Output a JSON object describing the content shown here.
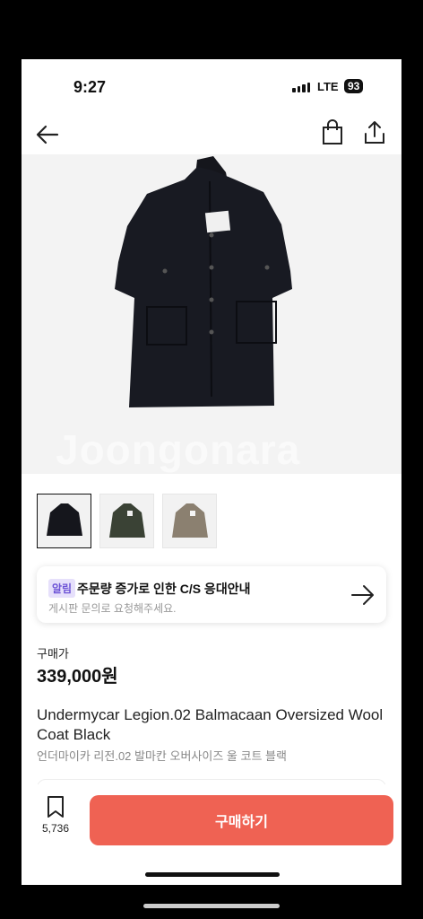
{
  "status_bar": {
    "time": "9:27",
    "network": "LTE",
    "battery": "93"
  },
  "header": {
    "back_icon": "arrow-left-icon",
    "bag_icon": "shopping-bag-icon",
    "share_icon": "share-icon"
  },
  "gallery": {
    "watermark": "Joongonara",
    "thumbnails": [
      {
        "color": "black",
        "active": true
      },
      {
        "color": "dark green",
        "active": false
      },
      {
        "color": "taupe",
        "active": false
      }
    ]
  },
  "notice": {
    "badge": "알림",
    "title": "주문량 증가로 인한 C/S 응대안내",
    "subtitle": "게시판 문의로 요청해주세요.",
    "arrow_icon": "arrow-right-icon"
  },
  "product": {
    "price_label": "구매가",
    "price": "339,000원",
    "name_en": "Undermycar Legion.02 Balmacaan Oversized Wool Coat Black",
    "name_ko": "언더마이카 리전.02 발마칸 오버사이즈 울 코트 블랙"
  },
  "bottom_bar": {
    "save_count": "5,736",
    "buy_label": "구매하기",
    "accent_color": "#ef6253"
  }
}
